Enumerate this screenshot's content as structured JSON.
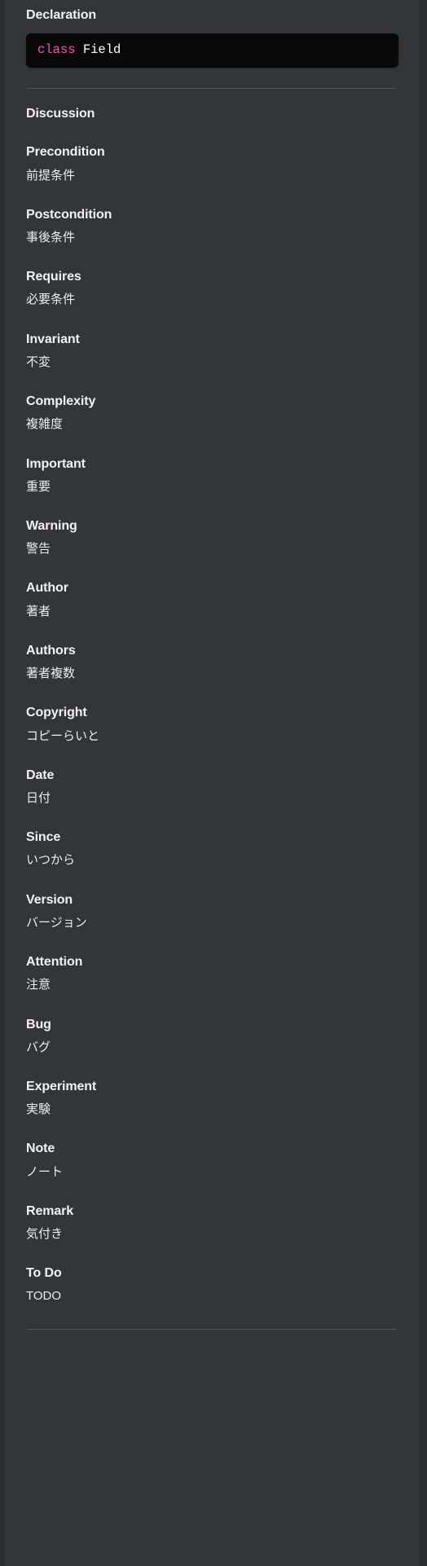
{
  "panel": {
    "background_color": "#32353a",
    "edge_color": "#2b2e33"
  },
  "declaration": {
    "heading": "Declaration",
    "code": {
      "keyword": "class",
      "space": " ",
      "identifier": "Field",
      "keyword_color": "#ff4eb6",
      "identifier_color": "#ffffff",
      "background_color": "#080808"
    }
  },
  "discussion": {
    "heading": "Discussion",
    "terms": [
      {
        "label": "Precondition",
        "value": "前提条件"
      },
      {
        "label": "Postcondition",
        "value": "事後条件"
      },
      {
        "label": "Requires",
        "value": "必要条件"
      },
      {
        "label": "Invariant",
        "value": "不変"
      },
      {
        "label": "Complexity",
        "value": "複雑度"
      },
      {
        "label": "Important",
        "value": "重要"
      },
      {
        "label": "Warning",
        "value": "警告"
      },
      {
        "label": "Author",
        "value": "著者"
      },
      {
        "label": "Authors",
        "value": "著者複数"
      },
      {
        "label": "Copyright",
        "value": "コピーらいと"
      },
      {
        "label": "Date",
        "value": "日付"
      },
      {
        "label": "Since",
        "value": "いつから"
      },
      {
        "label": "Version",
        "value": "バージョン"
      },
      {
        "label": "Attention",
        "value": "注意"
      },
      {
        "label": "Bug",
        "value": "バグ"
      },
      {
        "label": "Experiment",
        "value": "実験"
      },
      {
        "label": "Note",
        "value": "ノート"
      },
      {
        "label": "Remark",
        "value": "気付き"
      },
      {
        "label": "To Do",
        "value": "TODO"
      }
    ]
  }
}
